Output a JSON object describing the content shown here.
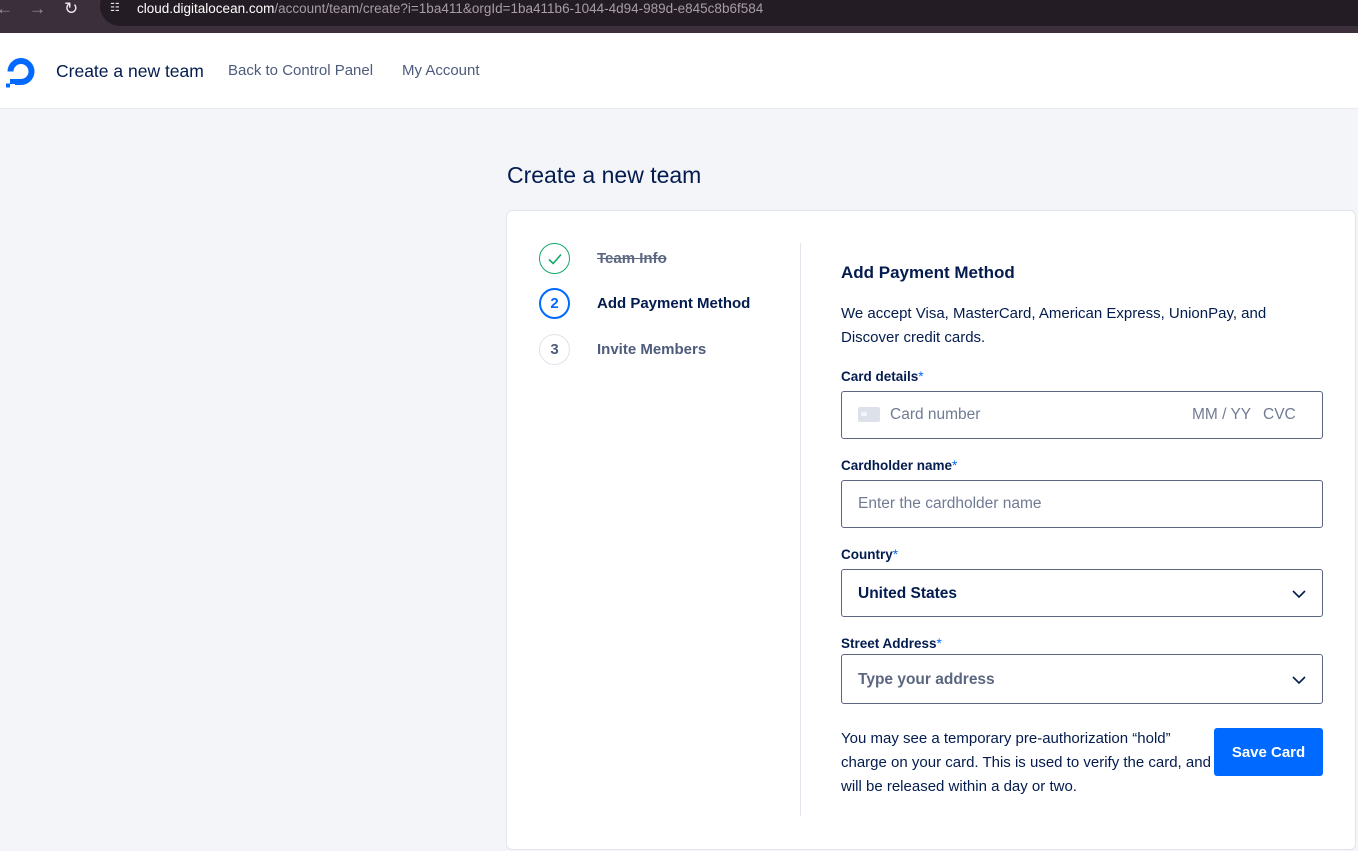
{
  "browser": {
    "url_host": "cloud.digitalocean.com",
    "url_path": "/account/team/create?i=1ba411&orgId=1ba411b6-1044-4d94-989d-e845c8b6f584",
    "back_icon": "←",
    "forward_icon": "→",
    "reload_icon": "↻",
    "site_info_icon": "☷"
  },
  "header": {
    "title": "Create a new team",
    "links": [
      "Back to Control Panel",
      "My Account"
    ]
  },
  "page": {
    "title": "Create a new team"
  },
  "steps": [
    {
      "number": "✓",
      "label": "Team Info",
      "state": "complete"
    },
    {
      "number": "2",
      "label": "Add Payment Method",
      "state": "active"
    },
    {
      "number": "3",
      "label": "Invite Members",
      "state": "pending"
    }
  ],
  "form": {
    "title": "Add Payment Method",
    "description": "We accept Visa, MasterCard, American Express, UnionPay, and Discover credit cards.",
    "card_details": {
      "label": "Card details",
      "required_mark": "*",
      "card_number_placeholder": "Card number",
      "expiry_placeholder": "MM / YY",
      "cvc_placeholder": "CVC"
    },
    "cardholder": {
      "label": "Cardholder name",
      "required_mark": "*",
      "placeholder": "Enter the cardholder name"
    },
    "country": {
      "label": "Country",
      "required_mark": "*",
      "value": "United States"
    },
    "address": {
      "label": "Street Address",
      "required_mark": "*",
      "placeholder": "Type your address"
    },
    "note": "You may see a temporary pre-authorization “hold” charge on your card. This is used to verify the card, and will be released within a day or two.",
    "save_label": "Save Card"
  },
  "colors": {
    "brand_blue": "#0069ff",
    "success_green": "#15a86a",
    "text_dark": "#031b4e",
    "page_bg": "#f4f5f9"
  }
}
